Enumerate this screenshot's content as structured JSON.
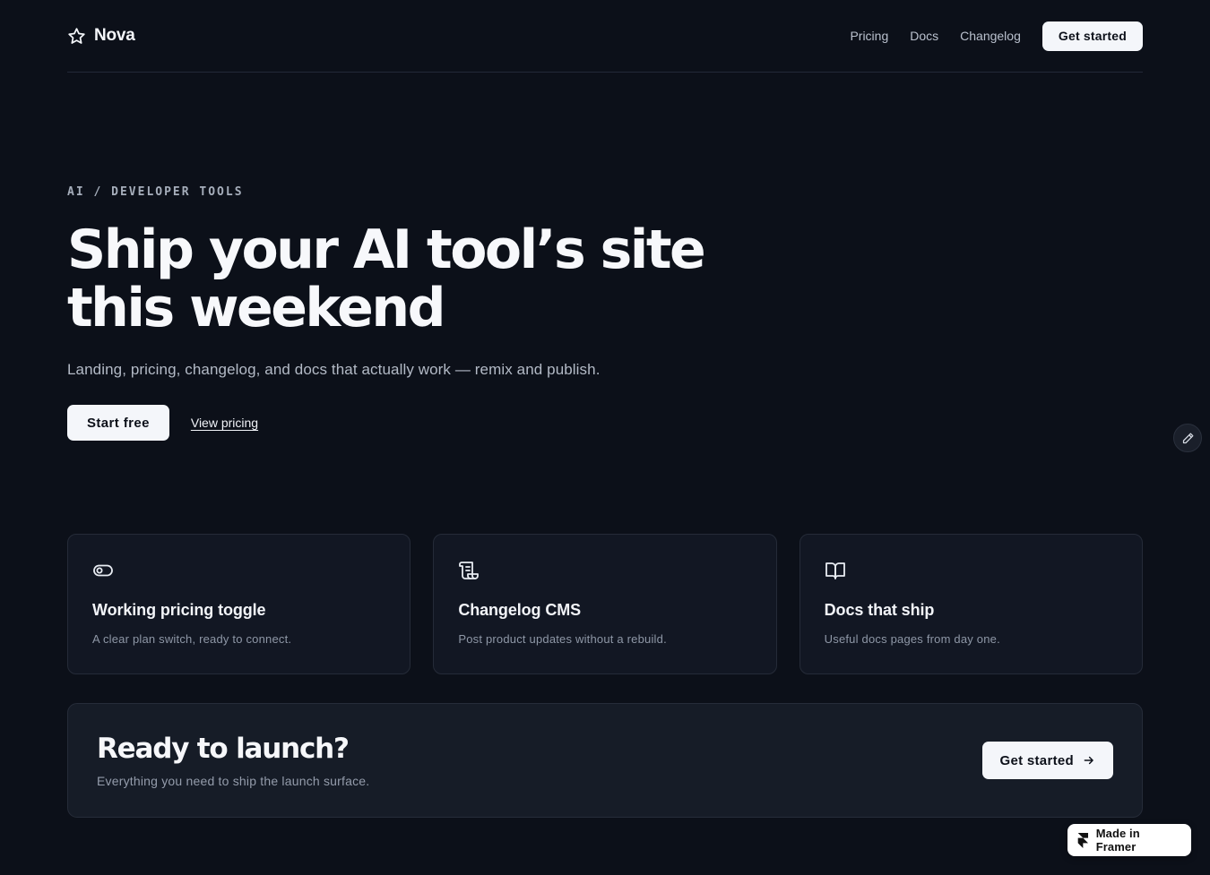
{
  "nav": {
    "brand": "Nova",
    "brand_icon": "star-icon",
    "links": [
      "Pricing",
      "Docs",
      "Changelog"
    ],
    "cta_label": "Get started"
  },
  "hero": {
    "eyebrow": "AI / DEVELOPER TOOLS",
    "title": "Ship your AI tool’s site this weekend",
    "subtitle": "Landing, pricing, changelog, and docs that actually work — remix and publish.",
    "primary_label": "Start free",
    "secondary_label": "View pricing"
  },
  "edit_button": {
    "icon": "pencil-icon"
  },
  "features": [
    {
      "icon": "toggle-icon",
      "title": "Working pricing toggle",
      "description": "A clear plan switch, ready to connect."
    },
    {
      "icon": "scroll-icon",
      "title": "Changelog CMS",
      "description": "Post product updates without a rebuild."
    },
    {
      "icon": "book-open-icon",
      "title": "Docs that ship",
      "description": "Useful docs pages from day one."
    }
  ],
  "cta": {
    "title": "Ready to launch?",
    "subtitle": "Everything you need to ship the launch surface.",
    "button_label": "Get started",
    "button_icon": "arrow-right-icon"
  },
  "badge": {
    "label": "Made in Framer",
    "icon": "framer-logo-icon"
  },
  "colors": {
    "background": "#0c1019",
    "card": "#121723",
    "cta_panel": "#161c27",
    "border": "#252b38",
    "text_primary": "#f4f6fa",
    "text_muted": "#8e97a6"
  }
}
